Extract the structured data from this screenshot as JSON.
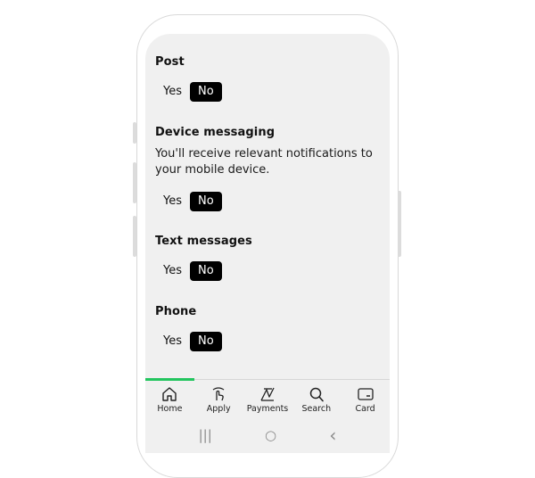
{
  "sections": [
    {
      "title": "Post",
      "description": "",
      "yes": "Yes",
      "no": "No",
      "selected": "No"
    },
    {
      "title": "Device messaging",
      "description": "You'll receive relevant notifications to your mobile device.",
      "yes": "Yes",
      "no": "No",
      "selected": "No"
    },
    {
      "title": "Text messages",
      "description": "",
      "yes": "Yes",
      "no": "No",
      "selected": "No"
    },
    {
      "title": "Phone",
      "description": "",
      "yes": "Yes",
      "no": "No",
      "selected": "No"
    }
  ],
  "nav": {
    "items": [
      {
        "label": "Home",
        "icon": "home-icon",
        "active": true
      },
      {
        "label": "Apply",
        "icon": "hand-pointer-icon",
        "active": false
      },
      {
        "label": "Payments",
        "icon": "payments-icon",
        "active": false
      },
      {
        "label": "Search",
        "icon": "search-icon",
        "active": false
      },
      {
        "label": "Card",
        "icon": "card-icon",
        "active": false
      }
    ],
    "active_color": "#22c55e"
  },
  "system_nav": {
    "recents": "|||",
    "home": "○",
    "back": "‹"
  }
}
